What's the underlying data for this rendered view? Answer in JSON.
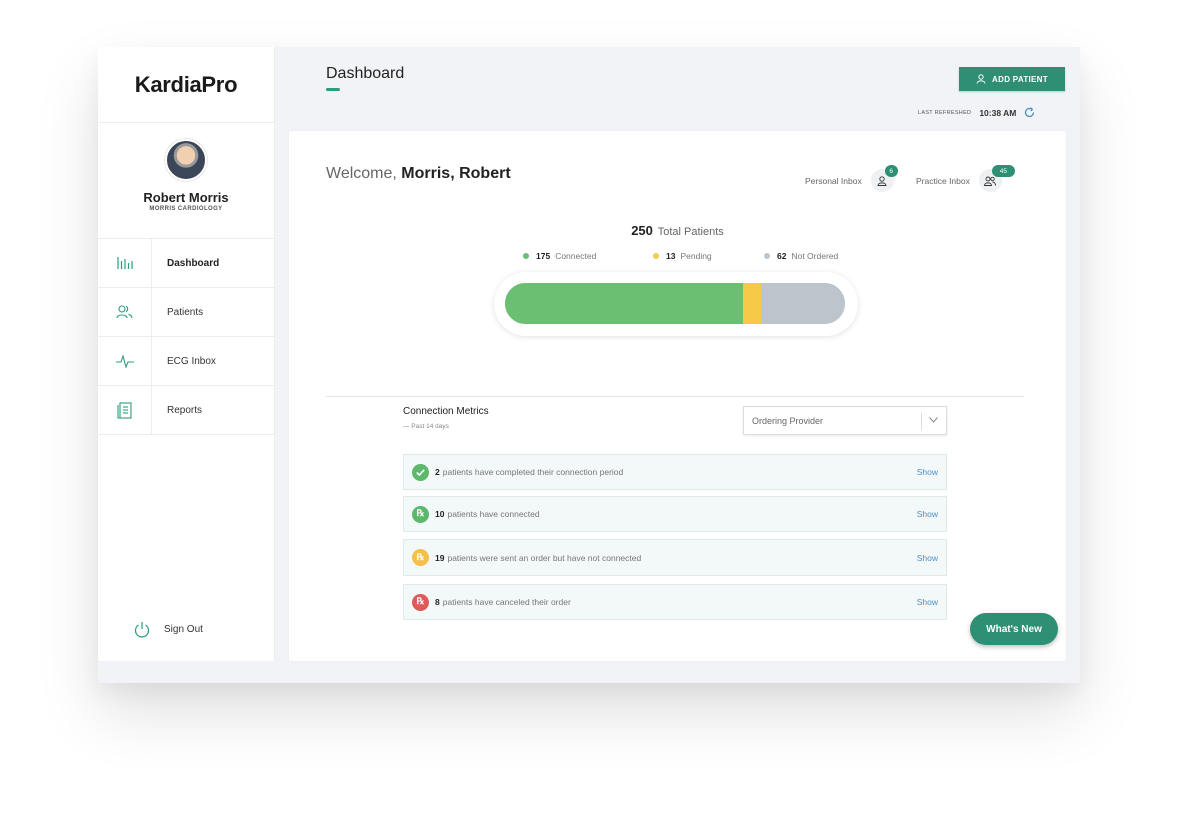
{
  "app": {
    "logo": "KardiaPro"
  },
  "profile": {
    "name": "Robert Morris",
    "org": "MORRIS CARDIOLOGY"
  },
  "nav": [
    {
      "label": "Dashboard",
      "icon": "bar-chart-icon",
      "active": true
    },
    {
      "label": "Patients",
      "icon": "users-icon"
    },
    {
      "label": "ECG Inbox",
      "icon": "ecg-pulse-icon"
    },
    {
      "label": "Reports",
      "icon": "document-icon"
    }
  ],
  "signout": {
    "label": "Sign Out",
    "icon": "power-icon"
  },
  "header": {
    "title": "Dashboard",
    "add_patient": "ADD PATIENT",
    "refreshed_label": "LAST REFRESHED",
    "refreshed_time": "10:38 AM"
  },
  "welcome": {
    "prefix": "Welcome,",
    "name": "Morris, Robert"
  },
  "inboxes": {
    "personal": {
      "label": "Personal Inbox",
      "count": "6"
    },
    "practice": {
      "label": "Practice Inbox",
      "count": "45"
    }
  },
  "patients": {
    "total": 250,
    "total_label": "Total Patients",
    "connected": {
      "count": 175,
      "label": "Connected",
      "color": "#6abf72"
    },
    "pending": {
      "count": 13,
      "label": "Pending",
      "color": "#f7c948"
    },
    "not_ordered": {
      "count": 62,
      "label": "Not Ordered",
      "color": "#bcc5cb"
    }
  },
  "metrics": {
    "title": "Connection Metrics",
    "subtitle": "— Past 14 days",
    "dropdown": "Ordering Provider",
    "show_label": "Show",
    "rows": [
      {
        "count": "2",
        "text": "patients have completed their connection period",
        "icon": "check-icon",
        "color": "#5cb96b"
      },
      {
        "count": "10",
        "text": "patients have connected",
        "icon": "rx-icon",
        "color": "#5cb96b"
      },
      {
        "count": "19",
        "text": "patients were sent an order but have not connected",
        "icon": "rx-icon",
        "color": "#f4c04a"
      },
      {
        "count": "8",
        "text": "patients have canceled their order",
        "icon": "rx-icon",
        "color": "#e05a5a"
      }
    ]
  },
  "whats_new": "What's New"
}
